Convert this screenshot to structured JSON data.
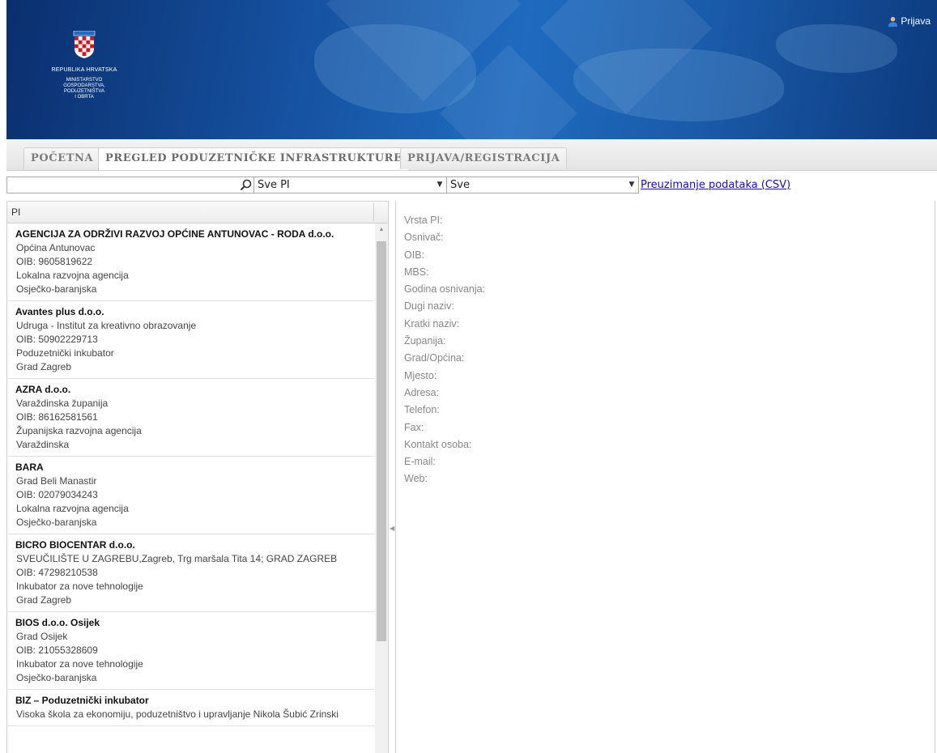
{
  "header": {
    "country": "REPUBLIKA HRVATSKA",
    "ministry_lines": [
      "MINISTARSTVO",
      "GOSPODARSTVA,",
      "PODUZETNIŠTVA",
      "I OBRTA"
    ],
    "login_label": "Prijava"
  },
  "nav": {
    "tabs": [
      {
        "label": "POČETNA"
      },
      {
        "label": "PREGLED PODUZETNIČKE INFRASTRUKTURE"
      },
      {
        "label": "PRIJAVA/REGISTRACIJA"
      }
    ]
  },
  "filters": {
    "search_value": "",
    "type_select": "Sve PI",
    "county_select": "Sve",
    "csv_link": "Preuzimanje podataka (CSV)"
  },
  "list": {
    "column_header": "PI",
    "items": [
      {
        "name": "AGENCIJA ZA ODRŽIVI RAZVOJ OPĆINE ANTUNOVAC - RODA d.o.o.",
        "founder": "Općina Antunovac",
        "oib": "OIB: 9605819622",
        "type": "Lokalna razvojna agencija",
        "county": "Osječko-baranjska"
      },
      {
        "name": "Avantes plus d.o.o.",
        "founder": "Udruga - Institut za kreativno obrazovanje",
        "oib": "OIB: 50902229713",
        "type": "Poduzetnički inkubator",
        "county": "Grad Zagreb"
      },
      {
        "name": "AZRA d.o.o.",
        "founder": "Varaždinska županija",
        "oib": "OIB: 86162581561",
        "type": "Županijska razvojna agencija",
        "county": "Varaždinska"
      },
      {
        "name": "BARA",
        "founder": "Grad Beli Manastir",
        "oib": "OIB: 02079034243",
        "type": "Lokalna razvojna agencija",
        "county": "Osječko-baranjska"
      },
      {
        "name": "BICRO BIOCENTAR d.o.o.",
        "founder": "SVEUČILIŠTE U ZAGREBU,Zagreb, Trg maršala Tita 14; GRAD ZAGREB",
        "oib": "OIB: 47298210538",
        "type": "Inkubator za nove tehnologije",
        "county": "Grad Zagreb"
      },
      {
        "name": "BIOS d.o.o. Osijek",
        "founder": "Grad Osijek",
        "oib": "OIB: 21055328609",
        "type": "Inkubator za nove tehnologije",
        "county": "Osječko-baranjska"
      },
      {
        "name": "BIZ – Poduzetnički inkubator",
        "founder": "Visoka škola za ekonomiju, poduzetništvo i upravljanje Nikola Šubić Zrinski",
        "oib": "",
        "type": "",
        "county": ""
      }
    ]
  },
  "detail": {
    "fields": [
      "Vrsta PI:",
      "Osnivač:",
      "OIB:",
      "MBS:",
      "Godina osnivanja:",
      "Dugi naziv:",
      "Kratki naziv:",
      "Županija:",
      "Grad/Općina:",
      "Mjesto:",
      "Adresa:",
      "Telefon:",
      "Fax:",
      "Kontakt osoba:",
      "E-mail:",
      "Web:"
    ]
  },
  "icons": {
    "search": "search-icon",
    "user": "user-icon",
    "coat_of_arms": "coat-of-arms-icon",
    "dropdown": "chevron-down-icon"
  },
  "colors": {
    "header_blue": "#15509e",
    "link": "#1a0dab"
  }
}
